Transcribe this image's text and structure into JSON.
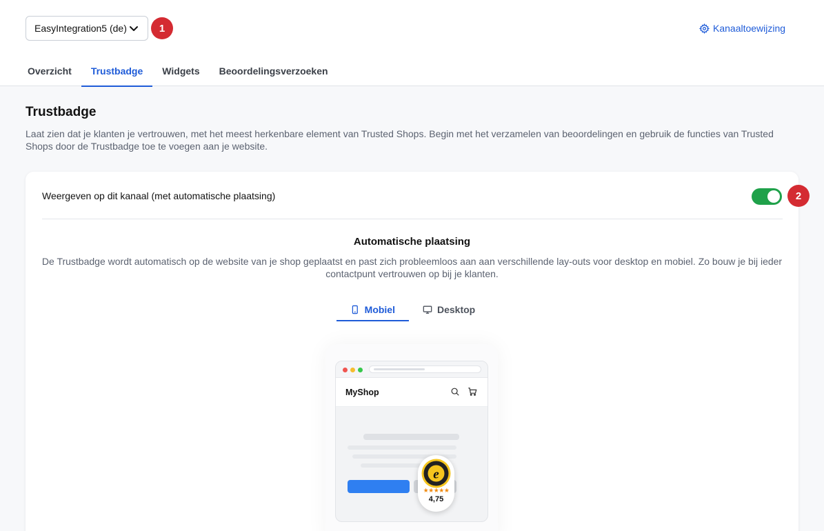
{
  "header": {
    "channel_select": "EasyIntegration5 (de)",
    "step_badge_1": "1",
    "channel_assignment_link": "Kanaaltoewijzing"
  },
  "tabs": [
    {
      "label": "Overzicht",
      "active": false
    },
    {
      "label": "Trustbadge",
      "active": true
    },
    {
      "label": "Widgets",
      "active": false
    },
    {
      "label": "Beoordelingsverzoeken",
      "active": false
    }
  ],
  "page": {
    "title": "Trustbadge",
    "description": "Laat zien dat je klanten je vertrouwen, met het meest herkenbare element van Trusted Shops. Begin met het verzamelen van beoordelingen en gebruik de functies van Trusted Shops door de Trustbadge toe te voegen aan je website."
  },
  "card": {
    "toggle_label": "Weergeven op dit kanaal (met automatische plaatsing)",
    "toggle_on": true,
    "step_badge_2": "2",
    "auto_title": "Automatische plaatsing",
    "auto_description": "De Trustbadge wordt automatisch op de website van je shop geplaatst en past zich probleemloos aan aan verschillende lay-outs voor desktop en mobiel. Zo bouw je bij ieder contactpunt vertrouwen op bij je klanten.",
    "device_tabs": [
      {
        "label": "Mobiel",
        "icon": "mobile-icon",
        "active": true
      },
      {
        "label": "Desktop",
        "icon": "desktop-icon",
        "active": false
      }
    ]
  },
  "preview": {
    "shop_name": "MyShop",
    "badge_stars": "★★★★★",
    "badge_score": "4,75"
  },
  "colors": {
    "accent": "#1e5bd8",
    "toggle_on": "#1fa14a",
    "step_badge": "#d42b32",
    "star": "#f08b12"
  }
}
